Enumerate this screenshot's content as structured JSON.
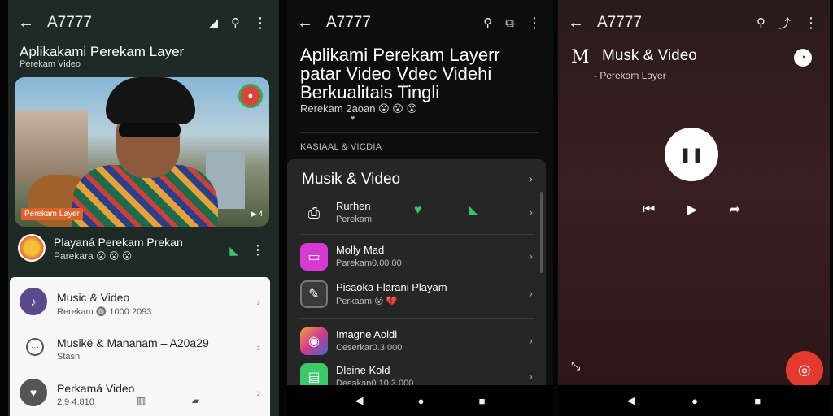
{
  "colors": {
    "accent_green": "#39c46a",
    "fab_red": "#e23a2f",
    "sheet_bg": "#f7f7f7",
    "panel_bg": "#262626"
  },
  "screen1": {
    "app_title": "A7777",
    "heading": "Aplikakami Perekam Layer",
    "subheading": "Perekam Video",
    "hero": {
      "tag_left": "Perekam Layer",
      "tag_right": "▶ 4"
    },
    "track": {
      "title": "Playaná Perekam Prekan",
      "subtitle": "Parekara 😮 😮 😮"
    },
    "list": [
      {
        "title": "Music & Video",
        "subtitle": "Rerekam 🔘 1000 2093"
      },
      {
        "title": "Musikё & Mananam – A20a29",
        "subtitle": "Stasn"
      },
      {
        "title": "Perkamá Video",
        "subtitle": "2.9 4.810"
      }
    ]
  },
  "screen2": {
    "app_title": "A7777",
    "headline_lines": [
      "Aplikami Perekam Layerr",
      "patar Video Vdec Videhi",
      "Berkualitais Tingli"
    ],
    "meta": "Rerekam 2aoan 😮 😮 😮",
    "section_label": "KASIAAL & VICDIA",
    "panel_title": "Musik & Video",
    "rows": [
      {
        "title": "Rurhen",
        "subtitle": "Perekam"
      },
      {
        "title": "Molly Mad",
        "subtitle": "Parekam0.00 00"
      },
      {
        "title": "Pisaoka Flarani Playam",
        "subtitle": "Perkaam 😮 💔"
      },
      {
        "title": "Imagne Aoldi",
        "subtitle": "Ceserkar0.3.000"
      },
      {
        "title": "Dleine Kold",
        "subtitle": "Desakan0.10.3.000"
      }
    ]
  },
  "screen3": {
    "app_title": "A7777",
    "logo": "M",
    "title": "Musk & Video",
    "subtitle": "- Perekam Layer"
  }
}
